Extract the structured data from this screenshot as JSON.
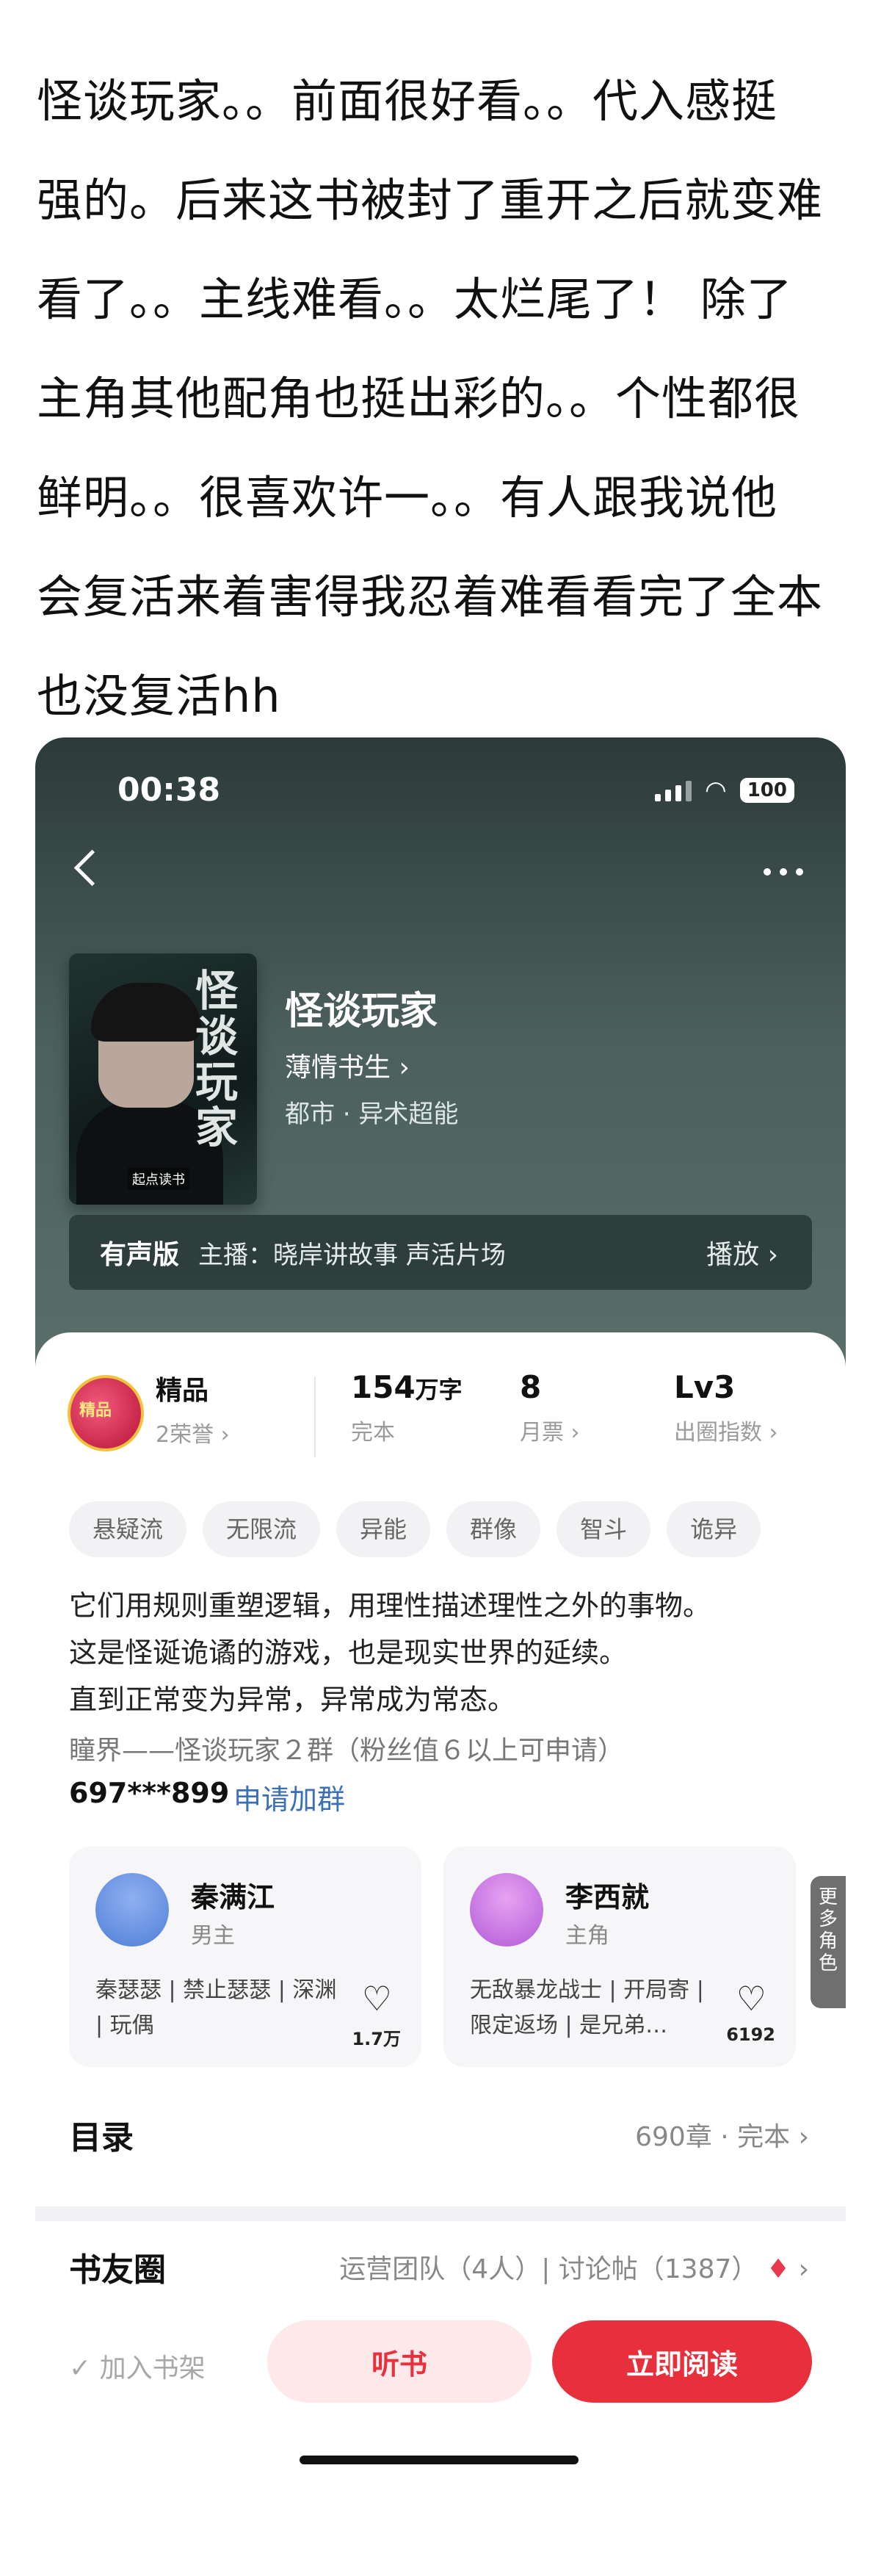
{
  "post": {
    "lines": [
      "怪谈玩家。。前面很好看。。代入感挺",
      "强的。后来这书被封了重开之后就变难",
      "看了。。主线难看。。太烂尾了！ 除了",
      "主角其他配角也挺出彩的。。个性都很",
      "鲜明。。很喜欢许一。。有人跟我说他",
      "会复活来着害得我忍着难看看完了全本",
      "也没复活hh"
    ]
  },
  "status": {
    "time": "00:38",
    "battery": "100"
  },
  "book": {
    "cover_title": "怪谈玩家",
    "cover_brand": "起点读书",
    "title": "怪谈玩家",
    "author": "薄情书生 ›",
    "genre": "都市 · 异术超能",
    "audio_tag": "有声版",
    "audio_host": "主播：晓岸讲故事  声活片场",
    "audio_play": "播放 ›"
  },
  "stats": {
    "badge_text": "精品",
    "quality": "精品",
    "honors": "2荣誉 ›",
    "words_num": "154",
    "words_unit": "万字",
    "words_status": "完本",
    "tickets": "8",
    "tickets_label": "月票 ›",
    "level": "Lv3",
    "level_label": "出圈指数 ›"
  },
  "tags": [
    "悬疑流",
    "无限流",
    "异能",
    "群像",
    "智斗",
    "诡异"
  ],
  "description": [
    "它们用规则重塑逻辑，用理性描述理性之外的事物。",
    "这是怪诞诡谲的游戏，也是现实世界的延续。",
    "直到正常变为异常，异常成为常态。"
  ],
  "group": {
    "text": "瞳界——怪谈玩家２群（粉丝值６以上可申请）",
    "id": "697***899",
    "join": "申请加群"
  },
  "roles": [
    {
      "name": "秦满江",
      "type": "男主",
      "desc": "秦瑟瑟 | 禁止瑟瑟 | 深渊 | 玩偶",
      "likes": "1.7万"
    },
    {
      "name": "李西就",
      "type": "主角",
      "desc": "无敌暴龙战士 | 开局寄 | 限定返场 | 是兄弟…",
      "likes": "6192"
    }
  ],
  "more_roles": "更多角色",
  "toc": {
    "title": "目录",
    "meta": "690章 · 完本 ›"
  },
  "circle": {
    "title": "书友圈",
    "meta": "运营团队（4人）| 讨论帖（1387）",
    "arrow": "›"
  },
  "bottom": {
    "shelf": "加入书架",
    "listen": "听书",
    "read": "立即阅读"
  },
  "colors": {
    "accent": "#e8303c",
    "hero": "#3d4f4d",
    "link": "#3b6fb6"
  }
}
